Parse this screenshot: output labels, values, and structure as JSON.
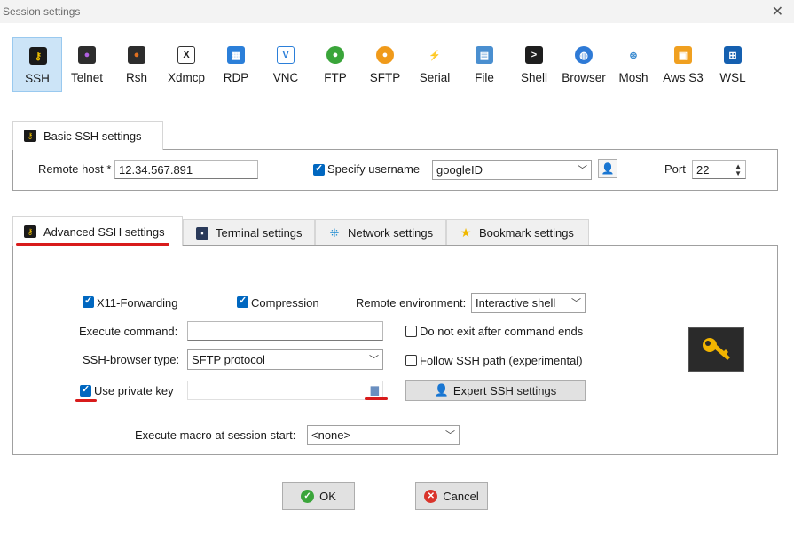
{
  "window": {
    "title": "Session settings",
    "close_label": "✕"
  },
  "protocols": [
    {
      "label": "SSH",
      "icon": "ssh-key-icon",
      "color": "#1a1a1a",
      "glyph": "🔑"
    },
    {
      "label": "Telnet",
      "icon": "telnet-icon",
      "color": "#2d2d2d",
      "glyph": "●"
    },
    {
      "label": "Rsh",
      "icon": "rsh-icon",
      "color": "#2d2d2d",
      "glyph": "●"
    },
    {
      "label": "Xdmcp",
      "icon": "xdmcp-icon",
      "color": "#3a3a3a",
      "glyph": "X"
    },
    {
      "label": "RDP",
      "icon": "rdp-icon",
      "color": "#2b7fd9",
      "glyph": "▦"
    },
    {
      "label": "VNC",
      "icon": "vnc-icon",
      "color": "#5a9fd4",
      "glyph": "V"
    },
    {
      "label": "FTP",
      "icon": "ftp-icon",
      "color": "#3aa53a",
      "glyph": "●"
    },
    {
      "label": "SFTP",
      "icon": "sftp-icon",
      "color": "#f09a1a",
      "glyph": "●"
    },
    {
      "label": "Serial",
      "icon": "serial-icon",
      "color": "#7a7a7a",
      "glyph": "⚡"
    },
    {
      "label": "File",
      "icon": "file-icon",
      "color": "#4a8fd0",
      "glyph": "▤"
    },
    {
      "label": "Shell",
      "icon": "shell-icon",
      "color": "#1e1e1e",
      "glyph": ">"
    },
    {
      "label": "Browser",
      "icon": "browser-icon",
      "color": "#2e7ad6",
      "glyph": "◍"
    },
    {
      "label": "Mosh",
      "icon": "mosh-icon",
      "color": "#3a8ad0",
      "glyph": "⊛"
    },
    {
      "label": "Aws S3",
      "icon": "aws-s3-icon",
      "color": "#f0a020",
      "glyph": "▣"
    },
    {
      "label": "WSL",
      "icon": "wsl-icon",
      "color": "#1560b0",
      "glyph": "⊞"
    }
  ],
  "basic": {
    "tab_label": "Basic SSH settings",
    "remote_host_label": "Remote host *",
    "remote_host_value": "12.34.567.891",
    "specify_username_label": "Specify username",
    "specify_username_checked": true,
    "username_value": "googleID",
    "port_label": "Port",
    "port_value": "22"
  },
  "tabs": [
    {
      "label": "Advanced SSH settings",
      "icon": "ssh-key-icon"
    },
    {
      "label": "Terminal settings",
      "icon": "terminal-icon"
    },
    {
      "label": "Network settings",
      "icon": "network-icon"
    },
    {
      "label": "Bookmark settings",
      "icon": "star-icon"
    }
  ],
  "advanced": {
    "x11_label": "X11-Forwarding",
    "compression_label": "Compression",
    "remote_env_label": "Remote environment:",
    "remote_env_value": "Interactive shell",
    "execute_command_label": "Execute command:",
    "execute_command_value": "",
    "do_not_exit_label": "Do not exit after command ends",
    "ssh_browser_label": "SSH-browser type:",
    "ssh_browser_value": "SFTP protocol",
    "follow_path_label": "Follow SSH path (experimental)",
    "use_private_key_label": "Use private key",
    "private_key_value": "",
    "expert_button_label": "Expert SSH settings",
    "macro_label": "Execute macro at session start:",
    "macro_value": "<none>"
  },
  "buttons": {
    "ok": "OK",
    "cancel": "Cancel"
  },
  "colors": {
    "accent": "#0067c0",
    "annotation_red": "#d81b1b",
    "selected_proto_bg": "#cce4f7"
  }
}
